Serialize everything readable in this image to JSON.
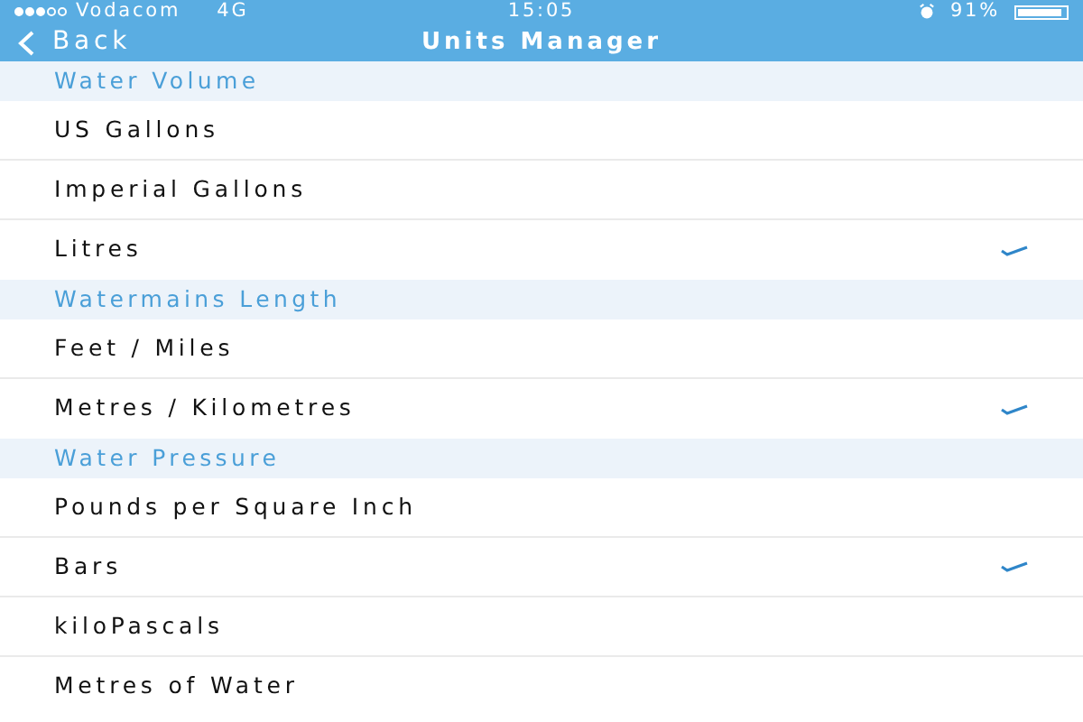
{
  "status_bar": {
    "signal_dots": [
      {
        "filled": true
      },
      {
        "filled": true
      },
      {
        "filled": true
      },
      {
        "filled": false
      },
      {
        "filled": false
      }
    ],
    "carrier": "Vodacom",
    "network": "4G",
    "time": "15:05",
    "battery_text": "91%",
    "battery": {
      "level": 0.91
    }
  },
  "nav_bar": {
    "back": "Back",
    "title": "Units Manager"
  },
  "sections": [
    {
      "title": "Water Volume",
      "items": [
        {
          "label": "US Gallons",
          "selected": false
        },
        {
          "label": "Imperial Gallons",
          "selected": false
        },
        {
          "label": "Litres",
          "selected": true
        }
      ]
    },
    {
      "title": "Watermains Length",
      "items": [
        {
          "label": "Feet / Miles",
          "selected": false
        },
        {
          "label": "Metres / Kilometres",
          "selected": true
        }
      ]
    },
    {
      "title": "Water Pressure",
      "items": [
        {
          "label": "Pounds per Square Inch",
          "selected": false
        },
        {
          "label": "Bars",
          "selected": true
        },
        {
          "label": "kiloPascals",
          "selected": false
        },
        {
          "label": "Metres of Water",
          "selected": false
        }
      ]
    }
  ]
}
